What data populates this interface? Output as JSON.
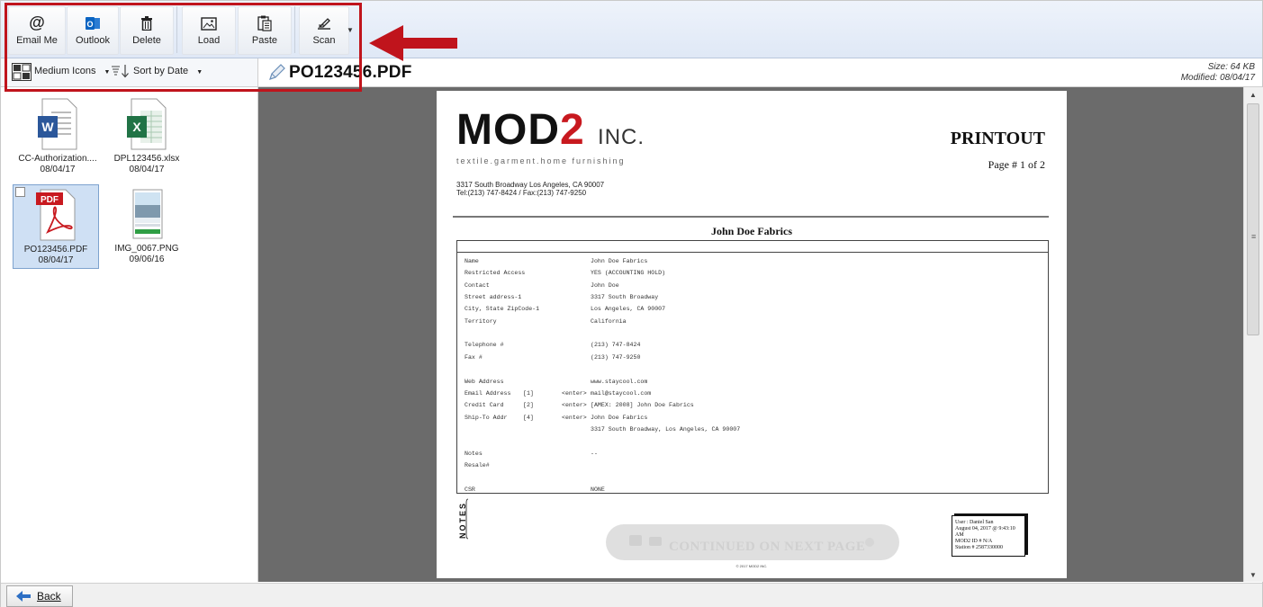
{
  "toolbar": {
    "buttons": [
      {
        "label": "Email Me",
        "icon": "at-icon"
      },
      {
        "label": "Outlook",
        "icon": "outlook-icon"
      },
      {
        "label": "Delete",
        "icon": "trash-icon"
      },
      {
        "label": "Load",
        "icon": "image-icon"
      },
      {
        "label": "Paste",
        "icon": "clipboard-icon"
      },
      {
        "label": "Scan",
        "icon": "scanner-icon"
      }
    ]
  },
  "view_options": {
    "icon_size": "Medium Icons",
    "sort": "Sort by Date"
  },
  "document": {
    "filename": "PO123456.PDF",
    "size": "Size: 64 KB",
    "modified": "Modified: 08/04/17"
  },
  "files": [
    {
      "name": "CC-Authorization....",
      "date": "08/04/17",
      "type": "word",
      "badge": "W"
    },
    {
      "name": "DPL123456.xlsx",
      "date": "08/04/17",
      "type": "excel",
      "badge": "X"
    },
    {
      "name": "PO123456.PDF",
      "date": "08/04/17",
      "type": "pdf",
      "badge": "PDF",
      "selected": true
    },
    {
      "name": "IMG_0067.PNG",
      "date": "09/06/16",
      "type": "image"
    }
  ],
  "pdf": {
    "logo_main": "MOD",
    "logo_accent": "2",
    "logo_suffix": "INC.",
    "tagline": "textile.garment.home furnishing",
    "address_line1": "3317 South Broadway  Los Angeles, CA 90007",
    "address_line2": "Tel:(213) 747-8424 / Fax:(213) 747-9250",
    "heading": "PRINTOUT",
    "page_label": "Page # 1 of 2",
    "customer": "John Doe Fabrics",
    "rows": [
      {
        "label": "Name",
        "idx": "",
        "enter": "",
        "value": "John Doe Fabrics"
      },
      {
        "label": "Restricted Access",
        "idx": "",
        "enter": "",
        "value": "YES (ACCOUNTING HOLD)"
      },
      {
        "label": "Contact",
        "idx": "",
        "enter": "",
        "value": "John Doe"
      },
      {
        "label": "Street address-1",
        "idx": "",
        "enter": "",
        "value": "3317 South Broadway"
      },
      {
        "label": "City, State  ZipCode-1",
        "idx": "",
        "enter": "",
        "value": "Los Angeles, CA 90007"
      },
      {
        "label": "Territory",
        "idx": "",
        "enter": "",
        "value": "California"
      },
      {
        "label": "",
        "idx": "",
        "enter": "",
        "value": ""
      },
      {
        "label": "Telephone #",
        "idx": "",
        "enter": "",
        "value": "(213) 747-8424"
      },
      {
        "label": "Fax #",
        "idx": "",
        "enter": "",
        "value": "(213) 747-9250"
      },
      {
        "label": "",
        "idx": "",
        "enter": "",
        "value": ""
      },
      {
        "label": "Web Address",
        "idx": "",
        "enter": "",
        "value": "www.staycool.com"
      },
      {
        "label": "Email Address",
        "idx": "[1]",
        "enter": "<enter>",
        "value": "mail@staycool.com"
      },
      {
        "label": "Credit Card",
        "idx": "[2]",
        "enter": "<enter>",
        "value": "[AMEX: 2008] John Doe Fabrics"
      },
      {
        "label": "Ship-To Addr",
        "idx": "[4]",
        "enter": "<enter>",
        "value": "John Doe Fabrics"
      },
      {
        "label": "",
        "idx": "",
        "enter": "",
        "value": "3317 South Broadway, Los Angeles, CA 90007"
      },
      {
        "label": "",
        "idx": "",
        "enter": "",
        "value": ""
      },
      {
        "label": "Notes",
        "idx": "",
        "enter": "",
        "value": "--"
      },
      {
        "label": "Resale#",
        "idx": "",
        "enter": "",
        "value": ""
      },
      {
        "label": "",
        "idx": "",
        "enter": "",
        "value": ""
      },
      {
        "label": "CSR",
        "idx": "",
        "enter": "",
        "value": "NONE"
      }
    ],
    "notes_label": "NOTES",
    "signature": {
      "user": "User : Daniel San",
      "datetime": "August 04, 2017 @ 9:43:10 AM",
      "mod2id": "MOD2 ID # N/A",
      "station": "Station # 2587330000"
    },
    "continued": "CONTINUED ON NEXT PAGE",
    "footer": "© 2017 MOD2 INC."
  },
  "bottom": {
    "back_label": "Back"
  },
  "colors": {
    "highlight": "#c0141c",
    "brand_red": "#c8191f",
    "viewer_bg": "#6b6b6b",
    "selection": "#cfe0f4"
  }
}
